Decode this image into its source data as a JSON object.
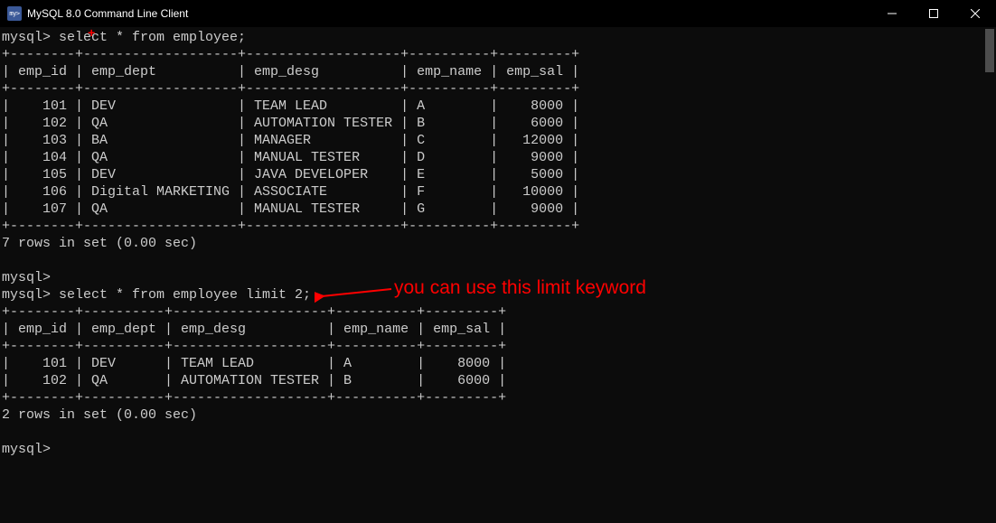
{
  "window": {
    "title": "MySQL 8.0 Command Line Client"
  },
  "terminal": {
    "prompt": "mysql>",
    "query1": "mysql> select * from employee;",
    "query2": "mysql> select * from employee limit 2;",
    "result1_status": "7 rows in set (0.00 sec)",
    "result2_status": "2 rows in set (0.00 sec)",
    "blank_prompt": "mysql>"
  },
  "table1": {
    "headers": [
      "emp_id",
      "emp_dept",
      "emp_desg",
      "emp_name",
      "emp_sal"
    ],
    "rows": [
      {
        "emp_id": "101",
        "emp_dept": "DEV",
        "emp_desg": "TEAM LEAD",
        "emp_name": "A",
        "emp_sal": "8000"
      },
      {
        "emp_id": "102",
        "emp_dept": "QA",
        "emp_desg": "AUTOMATION TESTER",
        "emp_name": "B",
        "emp_sal": "6000"
      },
      {
        "emp_id": "103",
        "emp_dept": "BA",
        "emp_desg": "MANAGER",
        "emp_name": "C",
        "emp_sal": "12000"
      },
      {
        "emp_id": "104",
        "emp_dept": "QA",
        "emp_desg": "MANUAL TESTER",
        "emp_name": "D",
        "emp_sal": "9000"
      },
      {
        "emp_id": "105",
        "emp_dept": "DEV",
        "emp_desg": "JAVA DEVELOPER",
        "emp_name": "E",
        "emp_sal": "5000"
      },
      {
        "emp_id": "106",
        "emp_dept": "Digital MARKETING",
        "emp_desg": "ASSOCIATE",
        "emp_name": "F",
        "emp_sal": "10000"
      },
      {
        "emp_id": "107",
        "emp_dept": "QA",
        "emp_desg": "MANUAL TESTER",
        "emp_name": "G",
        "emp_sal": "9000"
      }
    ]
  },
  "table2": {
    "headers": [
      "emp_id",
      "emp_dept",
      "emp_desg",
      "emp_name",
      "emp_sal"
    ],
    "rows": [
      {
        "emp_id": "101",
        "emp_dept": "DEV",
        "emp_desg": "TEAM LEAD",
        "emp_name": "A",
        "emp_sal": "8000"
      },
      {
        "emp_id": "102",
        "emp_dept": "QA",
        "emp_desg": "AUTOMATION TESTER",
        "emp_name": "B",
        "emp_sal": "6000"
      }
    ]
  },
  "annotation": {
    "text": "you can use this limit keyword",
    "color": "#ff0000"
  }
}
